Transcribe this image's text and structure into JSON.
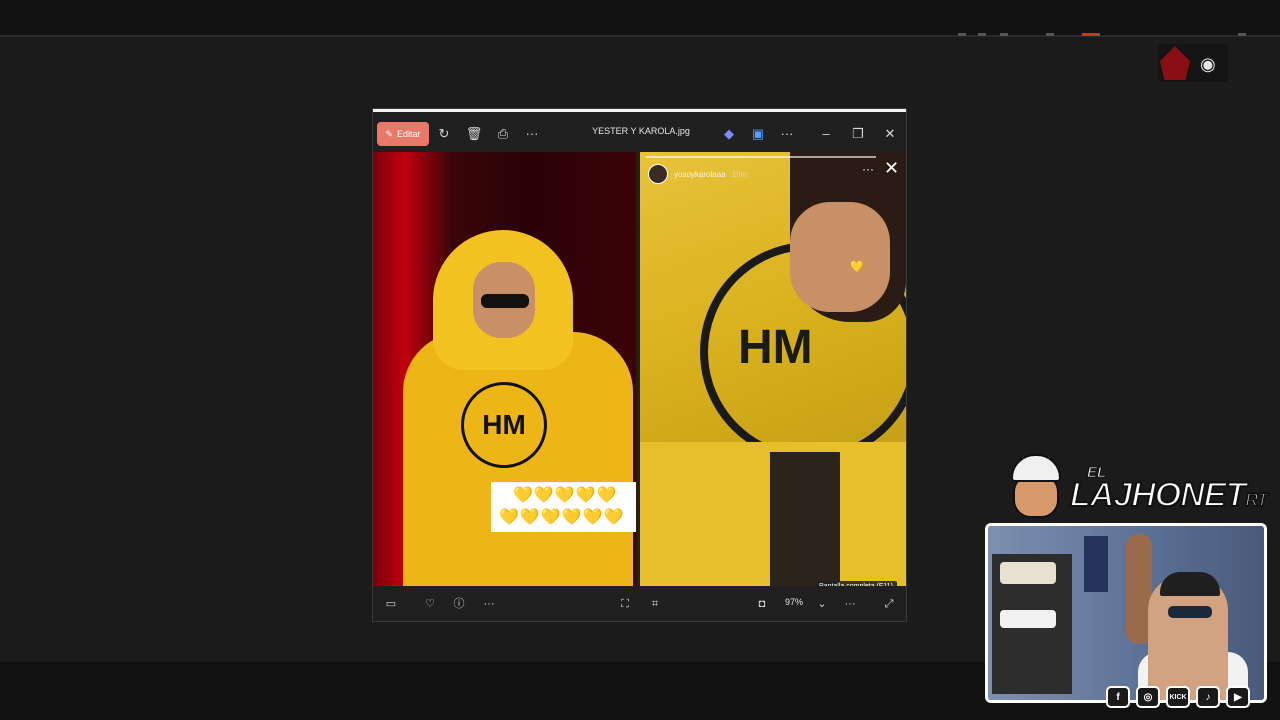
{
  "window": {
    "title": "YESTER Y KAROLA.jpg",
    "edit_label": "Editar"
  },
  "story": {
    "username": "yosoykarolaaa",
    "time": "19m"
  },
  "overlay": {
    "fullscreen_tooltip": "Pantalla completa (F11)"
  },
  "toolbar": {
    "zoom": "97%"
  },
  "brand": {
    "el": "EL",
    "name": "LAJHONET",
    "suffix": "RT"
  },
  "socials": [
    {
      "icon": "facebook-icon",
      "label": "f"
    },
    {
      "icon": "instagram-icon",
      "label": "◎"
    },
    {
      "icon": "kick-icon",
      "label": "KICK"
    },
    {
      "icon": "tiktok-icon",
      "label": "♪"
    },
    {
      "icon": "youtube-icon",
      "label": "▶"
    }
  ],
  "colors": {
    "edit_button": "#e8796a",
    "window_bg": "#202020",
    "desktop_bg": "#1b1b1b"
  }
}
